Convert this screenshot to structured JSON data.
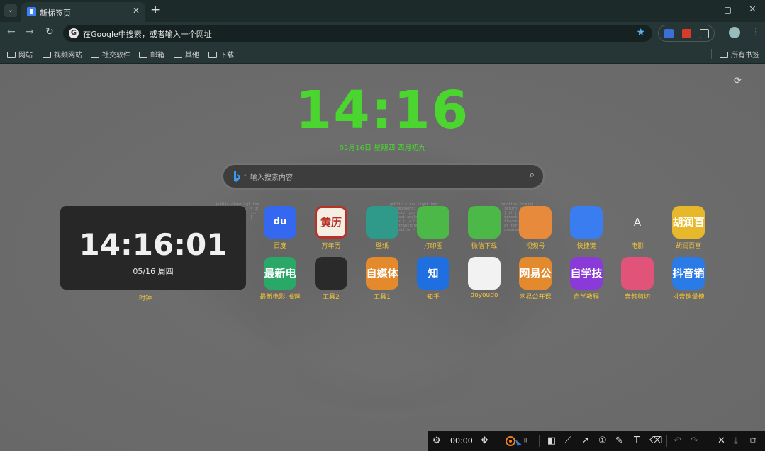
{
  "browser": {
    "tab_title": "新标签页",
    "tab_close": "✕",
    "new_tab": "+",
    "omnibox_text": "在Google中搜索，或者输入一个网址",
    "bookmarks": [
      "网站",
      "视频网站",
      "社交软件",
      "邮箱",
      "其他",
      "下载"
    ],
    "all_bookmarks": "所有书签"
  },
  "page": {
    "big_clock": "14:16",
    "date_line": "05月16日 星期四 四月初九",
    "search_placeholder": "输入搜索内容"
  },
  "clock_widget": {
    "time": "14:16:01",
    "date": "05/16 周四",
    "label": "时钟"
  },
  "apps": [
    {
      "label": "百度",
      "icon_text": "du",
      "icon": "baidu-paw-icon",
      "color": "#3568f0"
    },
    {
      "label": "万年历",
      "icon_text": "黄历",
      "icon": "calendar-icon",
      "color": "#b8322a"
    },
    {
      "label": "壁纸",
      "icon_text": "",
      "icon": "deer-wallpaper-icon",
      "color": "#2f9a8a"
    },
    {
      "label": "打印图",
      "icon_text": "",
      "icon": "wechat-icon",
      "color": "#4cb848"
    },
    {
      "label": "微信下载",
      "icon_text": "",
      "icon": "wechat-icon",
      "color": "#4cb848"
    },
    {
      "label": "视频号",
      "icon_text": "",
      "icon": "butterfly-icon",
      "color": "#e88a3c"
    },
    {
      "label": "快捷键",
      "icon_text": "",
      "icon": "eraser-icon",
      "color": "#3a7df0"
    },
    {
      "label": "电影",
      "icon_text": "A",
      "icon": "letter-a-icon",
      "color": "transparent"
    },
    {
      "label": "胡润百富",
      "icon_text": "胡润百",
      "icon": "text-icon",
      "color": "#e7b82a"
    },
    {
      "label": "最新电影-推荐",
      "icon_text": "最新电",
      "icon": "text-icon",
      "color": "#2aa868"
    },
    {
      "label": "工具2",
      "icon_text": "",
      "icon": "koala-icon",
      "color": "#2a2a2a"
    },
    {
      "label": "工具1",
      "icon_text": "自媒体",
      "icon": "text-icon",
      "color": "#e58a2c"
    },
    {
      "label": "知乎",
      "icon_text": "知",
      "icon": "zhihu-icon",
      "color": "#1f6fe0"
    },
    {
      "label": "doyoudo",
      "icon_text": "",
      "icon": "popsicle-icon",
      "color": "#f2f2f2"
    },
    {
      "label": "网易公开课",
      "icon_text": "网易公",
      "icon": "text-icon",
      "color": "#e38a2e"
    },
    {
      "label": "自学教程",
      "icon_text": "自学技",
      "icon": "text-icon",
      "color": "#8a3ad8"
    },
    {
      "label": "音频剪切",
      "icon_text": "",
      "icon": "image-mic-icon",
      "color": "#e2537a"
    },
    {
      "label": "抖音销量榜",
      "icon_text": "抖音销",
      "icon": "text-icon",
      "color": "#2a7ae8"
    }
  ],
  "capture_bar": {
    "timer": "00:00"
  }
}
